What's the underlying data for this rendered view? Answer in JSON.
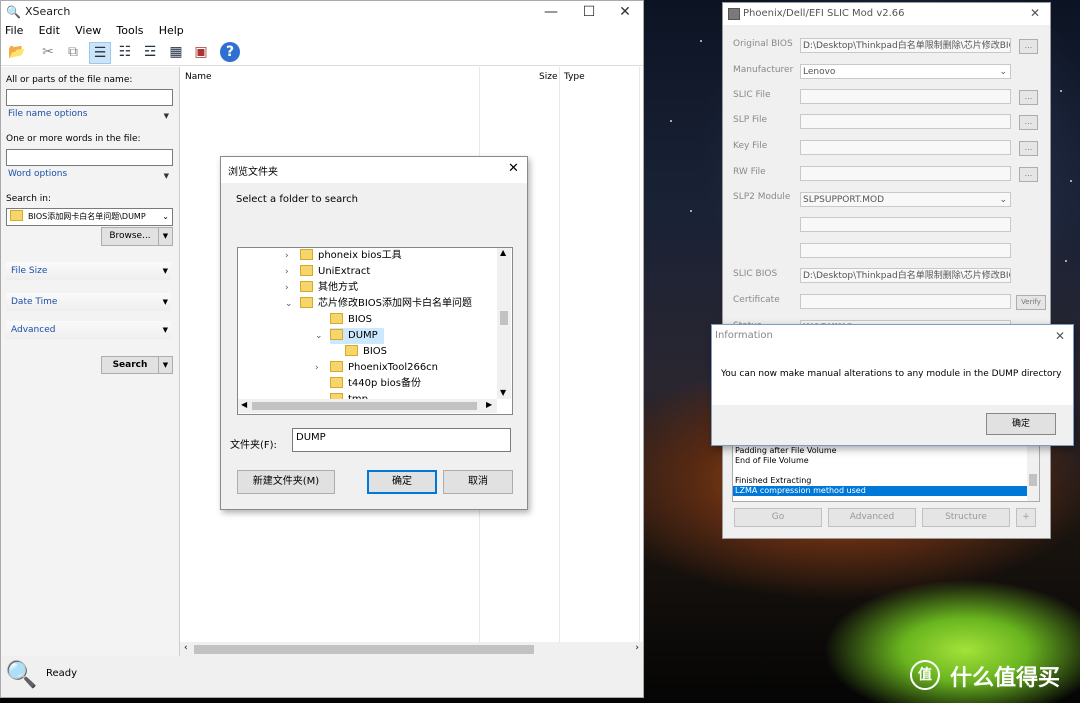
{
  "xsearch": {
    "title": "XSearch",
    "menu": [
      "File",
      "Edit",
      "View",
      "Tools",
      "Help"
    ],
    "filename_label": "All or parts of the file name:",
    "filename_value": "",
    "filename_options": "File name options",
    "words_label": "One or more words in the file:",
    "words_value": "",
    "word_options": "Word options",
    "search_in_label": "Search in:",
    "search_in_value": "BIOS添加网卡白名单问题\\DUMP",
    "browse": "Browse...",
    "file_size": "File Size",
    "date_time": "Date Time",
    "advanced": "Advanced",
    "search": "Search",
    "columns": {
      "name": "Name",
      "size": "Size",
      "type": "Type"
    },
    "status": "Ready"
  },
  "browse_dialog": {
    "title": "浏览文件夹",
    "prompt": "Select a folder to search",
    "tree": [
      {
        "label": "phoneix bios工具",
        "expander": "›"
      },
      {
        "label": "UniExtract",
        "expander": "›"
      },
      {
        "label": "其他方式",
        "expander": "›"
      },
      {
        "label": "芯片修改BIOS添加网卡白名单问题",
        "expander": "⌄"
      },
      {
        "label": "BIOS",
        "expander": ""
      },
      {
        "label": "DUMP",
        "expander": "⌄"
      },
      {
        "label": "BIOS",
        "expander": ""
      },
      {
        "label": "PhoenixTool266cn",
        "expander": "›"
      },
      {
        "label": "t440p bios备份",
        "expander": ""
      },
      {
        "label": "tmp",
        "expander": ""
      }
    ],
    "folder_label": "文件夹(F):",
    "folder_value": "DUMP",
    "new_folder": "新建文件夹(M)",
    "ok": "确定",
    "cancel": "取消"
  },
  "phoenix": {
    "title": "Phoenix/Dell/EFI SLIC Mod v2.66",
    "original_bios_label": "Original BIOS",
    "original_bios_value": "D:\\Desktop\\Thinkpad白名单限制删除\\芯片修改BIC",
    "manufacturer_label": "Manufacturer",
    "manufacturer_value": "Lenovo",
    "slic_file_label": "SLIC File",
    "slp_file_label": "SLP File",
    "key_file_label": "Key File",
    "rw_file_label": "RW File",
    "slp2_label": "SLP2 Module",
    "slp2_value": "SLPSUPPORT.MOD",
    "slic_bios_label": "SLIC BIOS",
    "slic_bios_value": "D:\\Desktop\\Thinkpad白名单限制删除\\芯片修改BIC",
    "certificate_label": "Certificate",
    "verify": "Verify",
    "status_label": "Status",
    "status_value": "WORKING",
    "browse_dots": "...",
    "log": [
      "Padding after File Volume",
      "End of File Volume",
      "",
      "Finished Extracting",
      "LZMA compression method used"
    ],
    "go": "Go",
    "advanced": "Advanced",
    "structure": "Structure",
    "more": "+"
  },
  "info_dialog": {
    "title": "Information",
    "message": "You can now make manual alterations to any module in the DUMP directory",
    "ok": "确定"
  },
  "watermark": "什么值得买"
}
